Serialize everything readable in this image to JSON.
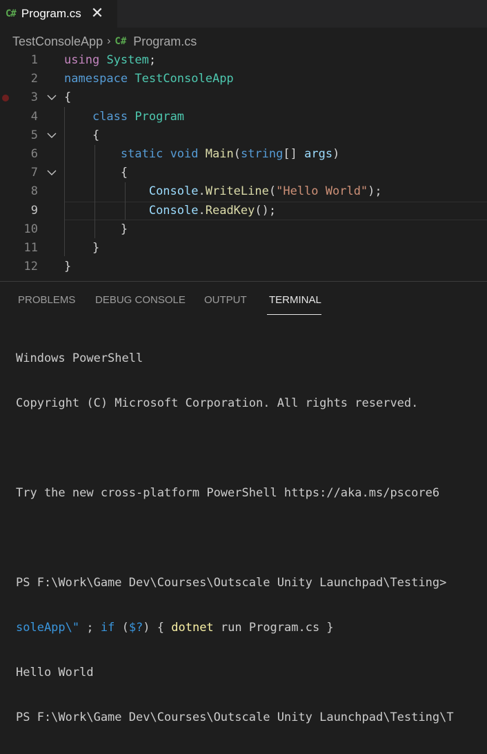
{
  "tab": {
    "icon": "C#",
    "title": "Program.cs",
    "close": "✕"
  },
  "breadcrumb": {
    "project": "TestConsoleApp",
    "sep": "›",
    "icon": "C#",
    "file": "Program.cs"
  },
  "editor": {
    "line_numbers": [
      "1",
      "2",
      "3",
      "4",
      "5",
      "6",
      "7",
      "8",
      "9",
      "10",
      "11",
      "12"
    ],
    "lines": [
      [
        {
          "t": "using",
          "c": "kw"
        },
        {
          "t": " ",
          "c": "pl"
        },
        {
          "t": "System",
          "c": "ty"
        },
        {
          "t": ";",
          "c": "pl"
        }
      ],
      [
        {
          "t": "namespace",
          "c": "kwb"
        },
        {
          "t": " ",
          "c": "pl"
        },
        {
          "t": "TestConsoleApp",
          "c": "ty"
        }
      ],
      [
        {
          "t": "{",
          "c": "pl"
        }
      ],
      [
        {
          "t": "    ",
          "c": "pl"
        },
        {
          "t": "class",
          "c": "kwb"
        },
        {
          "t": " ",
          "c": "pl"
        },
        {
          "t": "Program",
          "c": "ty"
        }
      ],
      [
        {
          "t": "    {",
          "c": "pl"
        }
      ],
      [
        {
          "t": "        ",
          "c": "pl"
        },
        {
          "t": "static",
          "c": "kwb"
        },
        {
          "t": " ",
          "c": "pl"
        },
        {
          "t": "void",
          "c": "kwb"
        },
        {
          "t": " ",
          "c": "pl"
        },
        {
          "t": "Main",
          "c": "fn"
        },
        {
          "t": "(",
          "c": "pl"
        },
        {
          "t": "string",
          "c": "kwb"
        },
        {
          "t": "[] ",
          "c": "pl"
        },
        {
          "t": "args",
          "c": "pa"
        },
        {
          "t": ")",
          "c": "pl"
        }
      ],
      [
        {
          "t": "        {",
          "c": "pl"
        }
      ],
      [
        {
          "t": "            ",
          "c": "pl"
        },
        {
          "t": "Console",
          "c": "pa"
        },
        {
          "t": ".",
          "c": "pl"
        },
        {
          "t": "WriteLine",
          "c": "fn"
        },
        {
          "t": "(",
          "c": "pl"
        },
        {
          "t": "\"Hello World\"",
          "c": "st"
        },
        {
          "t": ");",
          "c": "pl"
        }
      ],
      [
        {
          "t": "            ",
          "c": "pl"
        },
        {
          "t": "Console",
          "c": "pa"
        },
        {
          "t": ".",
          "c": "pl"
        },
        {
          "t": "ReadKey",
          "c": "fn"
        },
        {
          "t": "();",
          "c": "pl"
        }
      ],
      [
        {
          "t": "        }",
          "c": "pl"
        }
      ],
      [
        {
          "t": "    }",
          "c": "pl"
        }
      ],
      [
        {
          "t": "}",
          "c": "pl"
        }
      ]
    ]
  },
  "panel": {
    "tabs": [
      "PROBLEMS",
      "DEBUG CONSOLE",
      "OUTPUT",
      "TERMINAL"
    ],
    "active_tab": "TERMINAL"
  },
  "terminal": {
    "line1": "Windows PowerShell",
    "line2": "Copyright (C) Microsoft Corporation. All rights reserved.",
    "line3": "Try the new cross-platform PowerShell https://aka.ms/pscore6",
    "line4": "PS F:\\Work\\Game Dev\\Courses\\Outscale Unity Launchpad\\Testing>",
    "line5_a": "soleApp\\\"",
    "line5_b": " ; ",
    "line5_c": "if",
    "line5_d": " (",
    "line5_e": "$?",
    "line5_f": ") { ",
    "line5_g": "dotnet",
    "line5_h": " run Program.cs }",
    "line6": "Hello World",
    "line7": "PS F:\\Work\\Game Dev\\Courses\\Outscale Unity Launchpad\\Testing\\T"
  }
}
